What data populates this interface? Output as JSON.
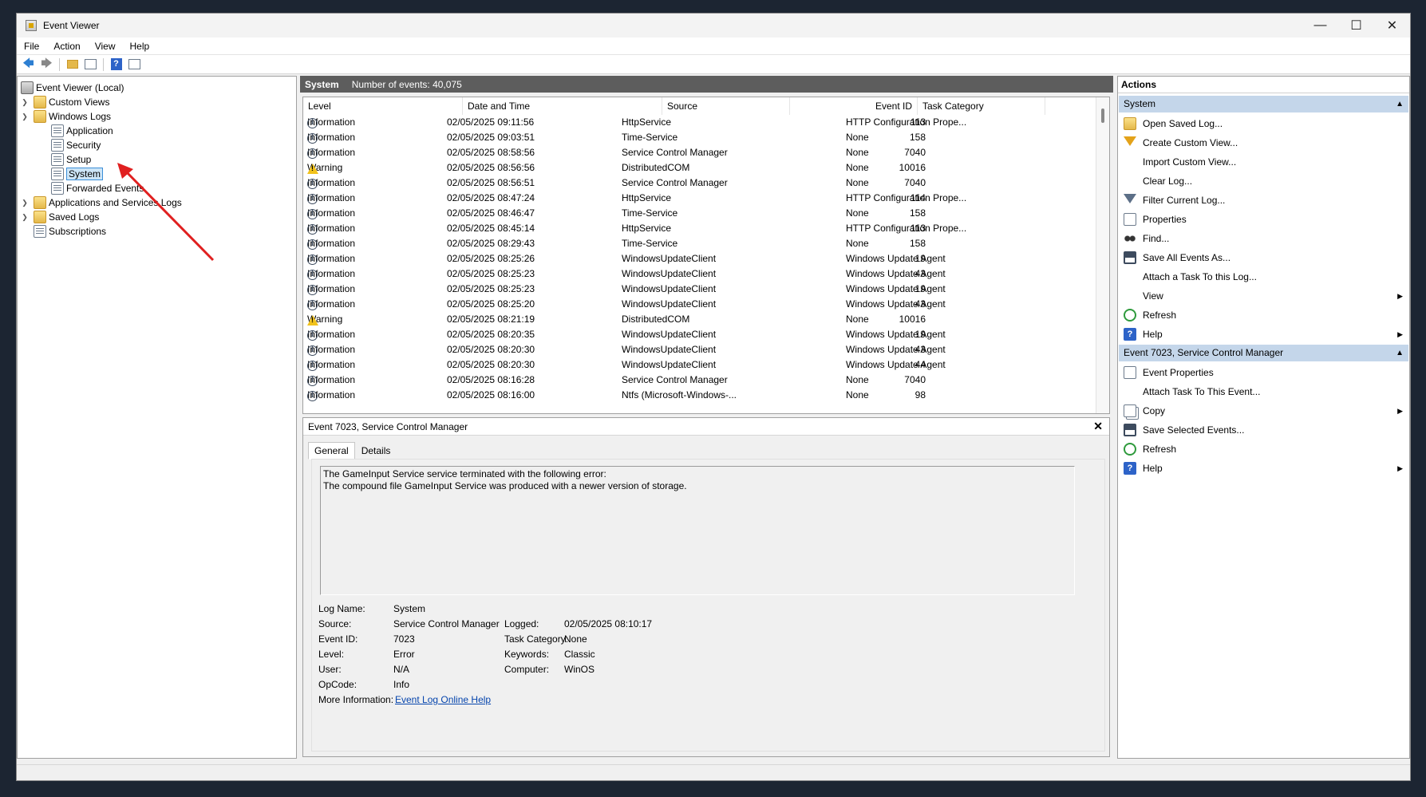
{
  "window": {
    "title": "Event Viewer"
  },
  "menu": [
    "File",
    "Action",
    "View",
    "Help"
  ],
  "tree": {
    "root": "Event Viewer (Local)",
    "custom_views": "Custom Views",
    "windows_logs": "Windows Logs",
    "application": "Application",
    "security": "Security",
    "setup": "Setup",
    "system": "System",
    "forwarded": "Forwarded Events",
    "app_services": "Applications and Services Logs",
    "saved_logs": "Saved Logs",
    "subscriptions": "Subscriptions"
  },
  "center": {
    "log_name": "System",
    "event_count": "Number of events: 40,075",
    "columns": {
      "level": "Level",
      "datetime": "Date and Time",
      "source": "Source",
      "eventid": "Event ID",
      "category": "Task Category"
    },
    "rows": [
      {
        "level": "Information",
        "type": "info",
        "datetime": "02/05/2025 09:11:56",
        "source": "HttpService",
        "id": "113",
        "category": "HTTP Configuration Prope..."
      },
      {
        "level": "Information",
        "type": "info",
        "datetime": "02/05/2025 09:03:51",
        "source": "Time-Service",
        "id": "158",
        "category": "None"
      },
      {
        "level": "Information",
        "type": "info",
        "datetime": "02/05/2025 08:58:56",
        "source": "Service Control Manager",
        "id": "7040",
        "category": "None"
      },
      {
        "level": "Warning",
        "type": "warn",
        "datetime": "02/05/2025 08:56:56",
        "source": "DistributedCOM",
        "id": "10016",
        "category": "None"
      },
      {
        "level": "Information",
        "type": "info",
        "datetime": "02/05/2025 08:56:51",
        "source": "Service Control Manager",
        "id": "7040",
        "category": "None"
      },
      {
        "level": "Information",
        "type": "info",
        "datetime": "02/05/2025 08:47:24",
        "source": "HttpService",
        "id": "114",
        "category": "HTTP Configuration Prope..."
      },
      {
        "level": "Information",
        "type": "info",
        "datetime": "02/05/2025 08:46:47",
        "source": "Time-Service",
        "id": "158",
        "category": "None"
      },
      {
        "level": "Information",
        "type": "info",
        "datetime": "02/05/2025 08:45:14",
        "source": "HttpService",
        "id": "113",
        "category": "HTTP Configuration Prope..."
      },
      {
        "level": "Information",
        "type": "info",
        "datetime": "02/05/2025 08:29:43",
        "source": "Time-Service",
        "id": "158",
        "category": "None"
      },
      {
        "level": "Information",
        "type": "info",
        "datetime": "02/05/2025 08:25:26",
        "source": "WindowsUpdateClient",
        "id": "19",
        "category": "Windows Update Agent"
      },
      {
        "level": "Information",
        "type": "info",
        "datetime": "02/05/2025 08:25:23",
        "source": "WindowsUpdateClient",
        "id": "43",
        "category": "Windows Update Agent"
      },
      {
        "level": "Information",
        "type": "info",
        "datetime": "02/05/2025 08:25:23",
        "source": "WindowsUpdateClient",
        "id": "19",
        "category": "Windows Update Agent"
      },
      {
        "level": "Information",
        "type": "info",
        "datetime": "02/05/2025 08:25:20",
        "source": "WindowsUpdateClient",
        "id": "43",
        "category": "Windows Update Agent"
      },
      {
        "level": "Warning",
        "type": "warn",
        "datetime": "02/05/2025 08:21:19",
        "source": "DistributedCOM",
        "id": "10016",
        "category": "None"
      },
      {
        "level": "Information",
        "type": "info",
        "datetime": "02/05/2025 08:20:35",
        "source": "WindowsUpdateClient",
        "id": "19",
        "category": "Windows Update Agent"
      },
      {
        "level": "Information",
        "type": "info",
        "datetime": "02/05/2025 08:20:30",
        "source": "WindowsUpdateClient",
        "id": "43",
        "category": "Windows Update Agent"
      },
      {
        "level": "Information",
        "type": "info",
        "datetime": "02/05/2025 08:20:30",
        "source": "WindowsUpdateClient",
        "id": "44",
        "category": "Windows Update Agent"
      },
      {
        "level": "Information",
        "type": "info",
        "datetime": "02/05/2025 08:16:28",
        "source": "Service Control Manager",
        "id": "7040",
        "category": "None"
      },
      {
        "level": "Information",
        "type": "info",
        "datetime": "02/05/2025 08:16:00",
        "source": "Ntfs (Microsoft-Windows-...",
        "id": "98",
        "category": "None"
      }
    ]
  },
  "detail": {
    "title": "Event 7023, Service Control Manager",
    "tabs": [
      "General",
      "Details"
    ],
    "description_line1": "The GameInput Service service terminated with the following error:",
    "description_line2": "The compound file GameInput Service was produced with a newer version of storage.",
    "labels": {
      "log_name": "Log Name:",
      "source": "Source:",
      "event_id": "Event ID:",
      "level": "Level:",
      "user": "User:",
      "opcode": "OpCode:",
      "more_info": "More Information:",
      "logged": "Logged:",
      "task_category": "Task Category:",
      "keywords": "Keywords:",
      "computer": "Computer:"
    },
    "values": {
      "log_name": "System",
      "source": "Service Control Manager",
      "event_id": "7023",
      "level": "Error",
      "user": "N/A",
      "opcode": "Info",
      "more_info_link": "Event Log Online Help",
      "logged": "02/05/2025 08:10:17",
      "task_category": "None",
      "keywords": "Classic",
      "computer": "WinOS"
    }
  },
  "actions": {
    "header": "Actions",
    "section1": "System",
    "section1_items": [
      "Open Saved Log...",
      "Create Custom View...",
      "Import Custom View...",
      "Clear Log...",
      "Filter Current Log...",
      "Properties",
      "Find...",
      "Save All Events As...",
      "Attach a Task To this Log...",
      "View",
      "Refresh",
      "Help"
    ],
    "section2": "Event 7023, Service Control Manager",
    "section2_items": [
      "Event Properties",
      "Attach Task To This Event...",
      "Copy",
      "Save Selected Events...",
      "Refresh",
      "Help"
    ]
  },
  "colors": {
    "accent_selection": "#cde5f7",
    "section_header": "#c4d6ea",
    "center_header": "#5d5d5d",
    "annotation_arrow": "#e02020"
  }
}
